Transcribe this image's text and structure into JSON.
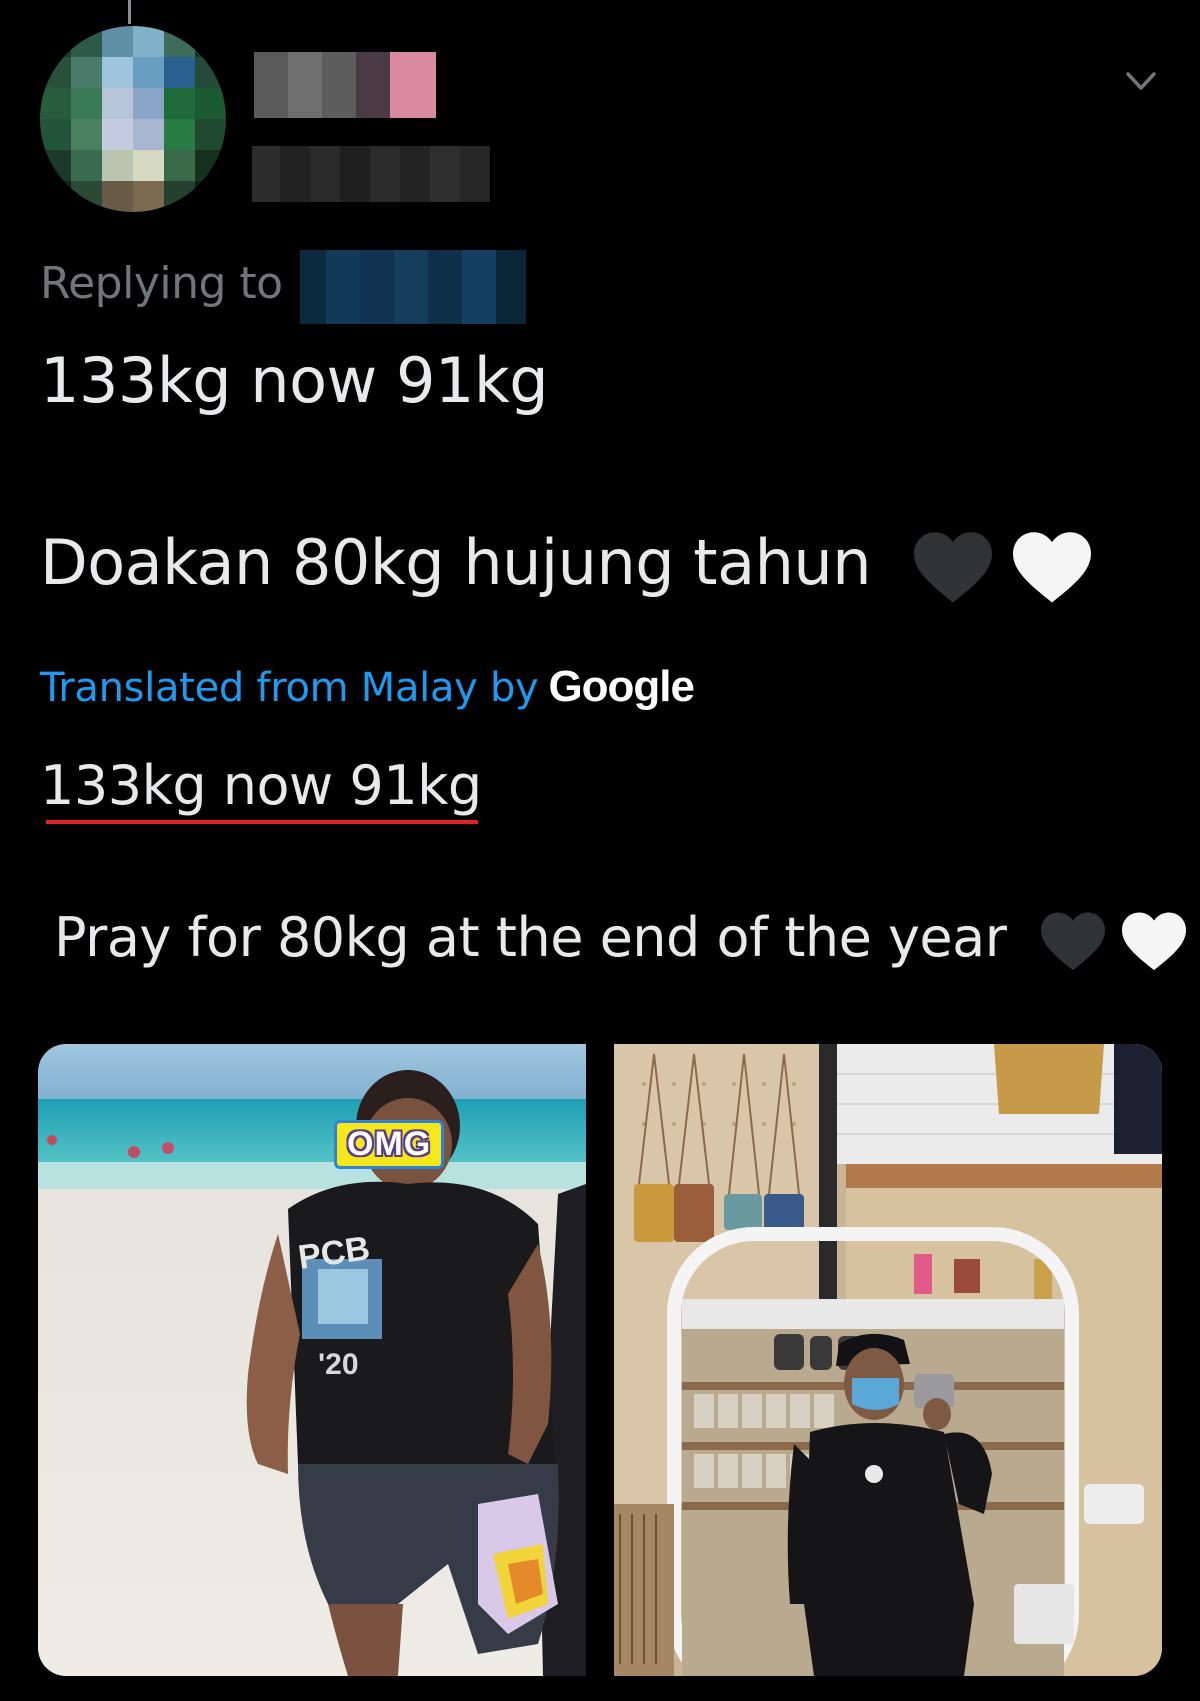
{
  "tweet": {
    "replying_to_label": "Replying to",
    "text_line_1": "133kg now 91kg",
    "text_line_2": "Doakan 80kg hujung tahun",
    "translation_label": "Translated from Malay by",
    "translation_provider": "Google",
    "translated_line_1": "133kg now 91kg",
    "translated_line_2": "Pray for 80kg at the end of the year"
  },
  "media": {
    "left_photo_sticker": "OMG"
  },
  "icons": {
    "menu_caret": "chevron-down-icon",
    "black_heart": "black-heart-icon",
    "white_heart": "white-heart-icon"
  },
  "colors": {
    "background": "#000000",
    "text": "#e7e9ea",
    "muted": "#71767b",
    "link": "#1d9bf0",
    "underline": "#e0232a"
  }
}
